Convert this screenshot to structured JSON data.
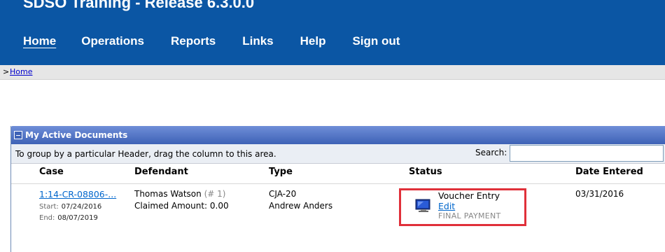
{
  "app": {
    "title": "SDSO Training - Release 6.3.0.0"
  },
  "nav": {
    "items": [
      "Home",
      "Operations",
      "Reports",
      "Links",
      "Help",
      "Sign out"
    ]
  },
  "breadcrumb": {
    "separator": ">",
    "home": "Home"
  },
  "panel": {
    "title": "My Active Documents",
    "group_hint": "To group by a particular Header, drag the column to this area.",
    "search_label": "Search:",
    "search_value": ""
  },
  "columns": [
    "Case",
    "Defendant",
    "Type",
    "Status",
    "Date Entered"
  ],
  "rows": [
    {
      "case": "1:14-CR-08806-...",
      "start_label": "Start:",
      "start": "07/24/2016",
      "end_label": "End:",
      "end": "08/07/2019",
      "defendant": "Thomas Watson",
      "defendant_num": "(# 1)",
      "claimed": "Claimed Amount: 0.00",
      "type": "CJA-20",
      "attorney": "Andrew Anders",
      "status": "Voucher Entry",
      "action": "Edit",
      "substatus": "FINAL PAYMENT",
      "date_entered": "03/31/2016"
    }
  ],
  "colors": {
    "header": "#0b56a4",
    "highlight": "#e0303a",
    "link": "#0066cc"
  }
}
